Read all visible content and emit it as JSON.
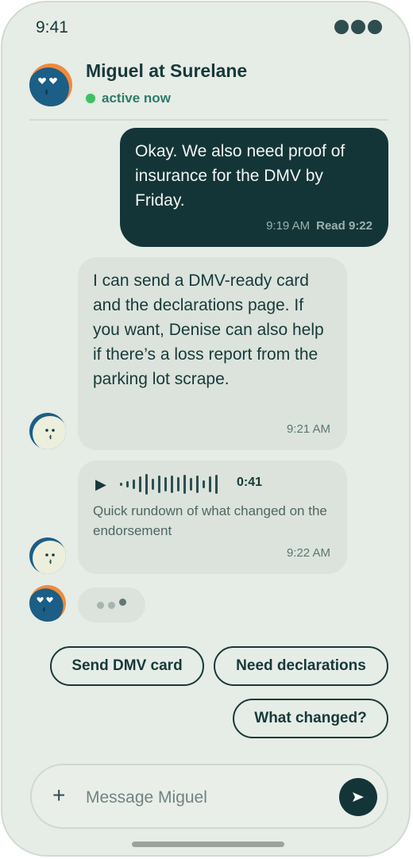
{
  "status_bar": {
    "time": "9:41"
  },
  "header": {
    "name": "Miguel at Surelane",
    "status": "active now"
  },
  "messages": [
    {
      "direction": "outgoing",
      "text": "Okay. We also need proof of insurance for the DMV by Friday.",
      "time": "9:19 AM",
      "read": "Read 9:22"
    },
    {
      "direction": "incoming",
      "text": "I can send a DMV-ready card and the declarations page. If you want, Denise can also help if there’s a loss report from the parking lot scrape.",
      "time": "9:21 AM"
    },
    {
      "direction": "incoming",
      "type": "voice",
      "duration": "0:41",
      "caption": "Quick rundown of what changed on the endorsement",
      "time": "9:22 AM"
    }
  ],
  "quick_replies": [
    "Send DMV card",
    "Need declarations",
    "What changed?"
  ],
  "composer": {
    "placeholder": "Message Miguel"
  },
  "colors": {
    "dark": "#143538",
    "background": "#e6ece6",
    "bubble_in": "#dbe3dc",
    "active": "#3fbf63",
    "avatar_blue": "#1b5e86",
    "avatar_orange": "#f08a3c"
  },
  "icons": {
    "play": "play-icon",
    "send": "send-icon",
    "add": "plus-icon",
    "signal": "status-dots-icon"
  }
}
